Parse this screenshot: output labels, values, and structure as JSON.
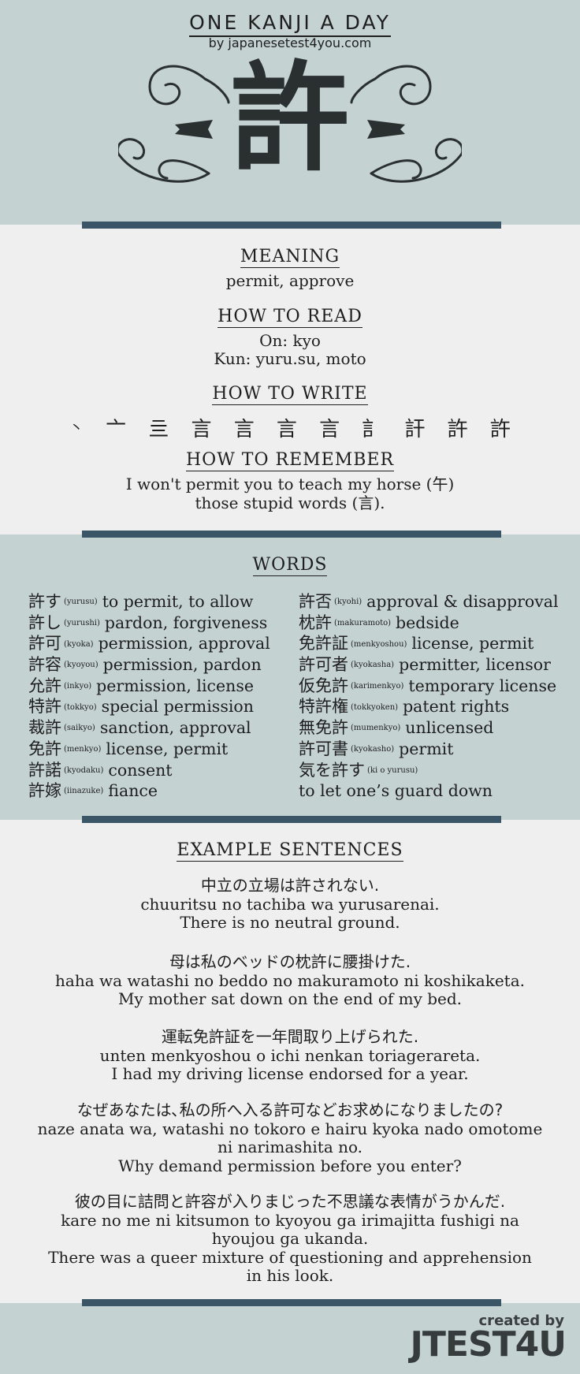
{
  "header": {
    "title": "ONE KANJI A DAY",
    "subtitle": "by japanesetest4you.com",
    "kanji": "許"
  },
  "meaning": {
    "heading": "MEANING",
    "text": "permit, approve"
  },
  "reading": {
    "heading": "HOW TO READ",
    "on": "On: kyo",
    "kun": "Kun: yuru.su, moto"
  },
  "writing": {
    "heading": "HOW TO WRITE",
    "strokes": [
      "丶",
      "亠",
      "亖",
      "言",
      "言",
      "言",
      "言",
      "訁",
      "訐",
      "許",
      "許"
    ]
  },
  "remember": {
    "heading": "HOW TO REMEMBER",
    "line1": "I won't permit you to teach my horse (午)",
    "line2": "those stupid words (言)."
  },
  "words": {
    "heading": "WORDS",
    "left": [
      {
        "kanji": "許す",
        "reading": "(yurusu)",
        "meaning": "to permit, to allow"
      },
      {
        "kanji": "許し",
        "reading": "(yurushi)",
        "meaning": "pardon, forgiveness"
      },
      {
        "kanji": "許可",
        "reading": "(kyoka)",
        "meaning": "permission, approval"
      },
      {
        "kanji": "許容",
        "reading": "(kyoyou)",
        "meaning": "permission, pardon"
      },
      {
        "kanji": "允許",
        "reading": "(inkyo)",
        "meaning": "permission, license"
      },
      {
        "kanji": "特許",
        "reading": "(tokkyo)",
        "meaning": "special permission"
      },
      {
        "kanji": "裁許",
        "reading": "(saikyo)",
        "meaning": "sanction, approval"
      },
      {
        "kanji": "免許",
        "reading": "(menkyo)",
        "meaning": "license, permit"
      },
      {
        "kanji": "許諾",
        "reading": "(kyodaku)",
        "meaning": "consent"
      },
      {
        "kanji": "許嫁",
        "reading": "(iinazuke)",
        "meaning": "fiance"
      }
    ],
    "right": [
      {
        "kanji": "許否",
        "reading": "(kyohi)",
        "meaning": "approval & disapproval"
      },
      {
        "kanji": "枕許",
        "reading": "(makuramoto)",
        "meaning": "bedside"
      },
      {
        "kanji": "免許証",
        "reading": "(menkyoshou)",
        "meaning": "license, permit"
      },
      {
        "kanji": "許可者",
        "reading": "(kyokasha)",
        "meaning": "permitter, licensor"
      },
      {
        "kanji": "仮免許",
        "reading": "(karimenkyo)",
        "meaning": "temporary license"
      },
      {
        "kanji": "特許権",
        "reading": "(tokkyoken)",
        "meaning": "patent rights"
      },
      {
        "kanji": "無免許",
        "reading": "(mumenkyo)",
        "meaning": "unlicensed"
      },
      {
        "kanji": "許可書",
        "reading": "(kyokasho)",
        "meaning": "permit"
      },
      {
        "kanji": "気を許す",
        "reading": "(ki o yurusu)",
        "meaning": ""
      },
      {
        "kanji": "",
        "reading": "",
        "meaning": "to let one’s guard down"
      }
    ]
  },
  "examples": {
    "heading": "EXAMPLE SENTENCES",
    "items": [
      {
        "jp": "中立の立場は許されない.",
        "romaji": [
          "chuuritsu no tachiba wa yurusarenai."
        ],
        "en": [
          "There is no neutral ground."
        ]
      },
      {
        "jp": "母は私のベッドの枕許に腰掛けた.",
        "romaji": [
          "haha wa watashi no beddo no makuramoto ni koshikaketa."
        ],
        "en": [
          "My mother sat down on the end of my bed."
        ]
      },
      {
        "jp": "運転免許証を一年間取り上げられた.",
        "romaji": [
          "unten menkyoshou o ichi nenkan toriagerareta."
        ],
        "en": [
          "I had my driving license endorsed for a year."
        ]
      },
      {
        "jp": "なぜあなたは､私の所へ入る許可などお求めになりましたの?",
        "romaji": [
          "naze anata wa, watashi no tokoro e hairu kyoka nado omotome",
          "ni narimashita no."
        ],
        "en": [
          "Why demand permission before you enter?"
        ]
      },
      {
        "jp": "彼の目に詰問と許容が入りまじった不思議な表情がうかんだ.",
        "romaji": [
          "kare no me ni kitsumon to kyoyou ga irimajitta fushigi na",
          "hyoujou ga ukanda."
        ],
        "en": [
          "There was a queer mixture of questioning and apprehension",
          "in his look."
        ]
      }
    ]
  },
  "credit": {
    "small": "created by",
    "big": "JTEST4U"
  },
  "colors": {
    "band": "#c5d2d2",
    "divider": "#3a5566",
    "background": "#efefef"
  }
}
